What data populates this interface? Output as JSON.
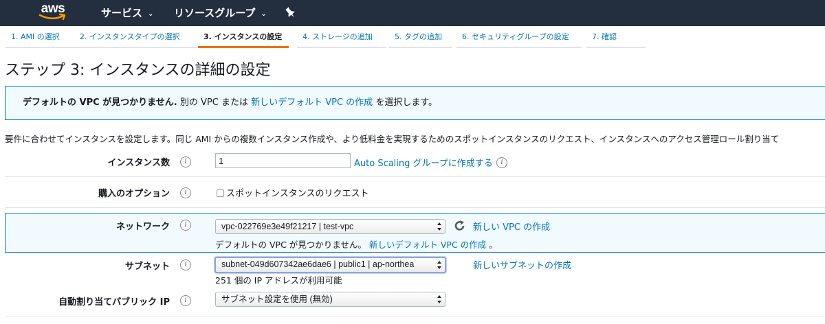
{
  "header": {
    "logo_text": "aws",
    "services_label": "サービス",
    "resource_groups_label": "リソースグループ",
    "chevron_glyph": "⌄"
  },
  "tabs": [
    {
      "label": "1. AMI の選択"
    },
    {
      "label": "2. インスタンスタイプの選択"
    },
    {
      "label": "3. インスタンスの設定"
    },
    {
      "label": "4. ストレージの追加"
    },
    {
      "label": "5. タグの追加"
    },
    {
      "label": "6. セキュリティグループの設定"
    },
    {
      "label": "7. 確認"
    }
  ],
  "page": {
    "title": "ステップ 3: インスタンスの詳細の設定",
    "description": "要件に合わせてインスタンスを設定します。同じ AMI からの複数インスタンス作成や、より低料金を実現するためのスポットインスタンスのリクエスト、インスタンスへのアクセス管理ロール割り当て"
  },
  "alert": {
    "bold_text": "デフォルトの VPC が見つかりません.",
    "text_before_link": "別の VPC または",
    "link_text": "新しいデフォルト VPC の作成",
    "text_after_link": "を選択します。"
  },
  "form": {
    "instance_count": {
      "label": "インスタンス数",
      "value": "1",
      "autoscaling_link": "Auto Scaling グループに作成する"
    },
    "purchase_option": {
      "label": "購入のオプション",
      "checkbox_label": "スポットインスタンスのリクエスト"
    },
    "network": {
      "label": "ネットワーク",
      "selected": "vpc-022769e3e49f21217 | test-vpc",
      "new_vpc_link": "新しい VPC の作成",
      "warning_text": "デフォルトの VPC が見つかりません。",
      "warning_link": "新しいデフォルト VPC の作成",
      "warning_end": "。"
    },
    "subnet": {
      "label": "サブネット",
      "selected": "subnet-049d607342ae6dae6 | public1 | ap-northea",
      "new_subnet_link": "新しいサブネットの作成",
      "available_ips": "251 個の IP アドレスが利用可能"
    },
    "public_ip": {
      "label": "自動割り当てパブリック IP",
      "selected": "サブネット設定を使用 (無効)"
    }
  },
  "info_glyph": "i",
  "colors": {
    "nav_bg": "#232f3e",
    "link": "#0073bb",
    "active_tab_accent": "#ec7211",
    "alert_bg": "#f1faff"
  }
}
